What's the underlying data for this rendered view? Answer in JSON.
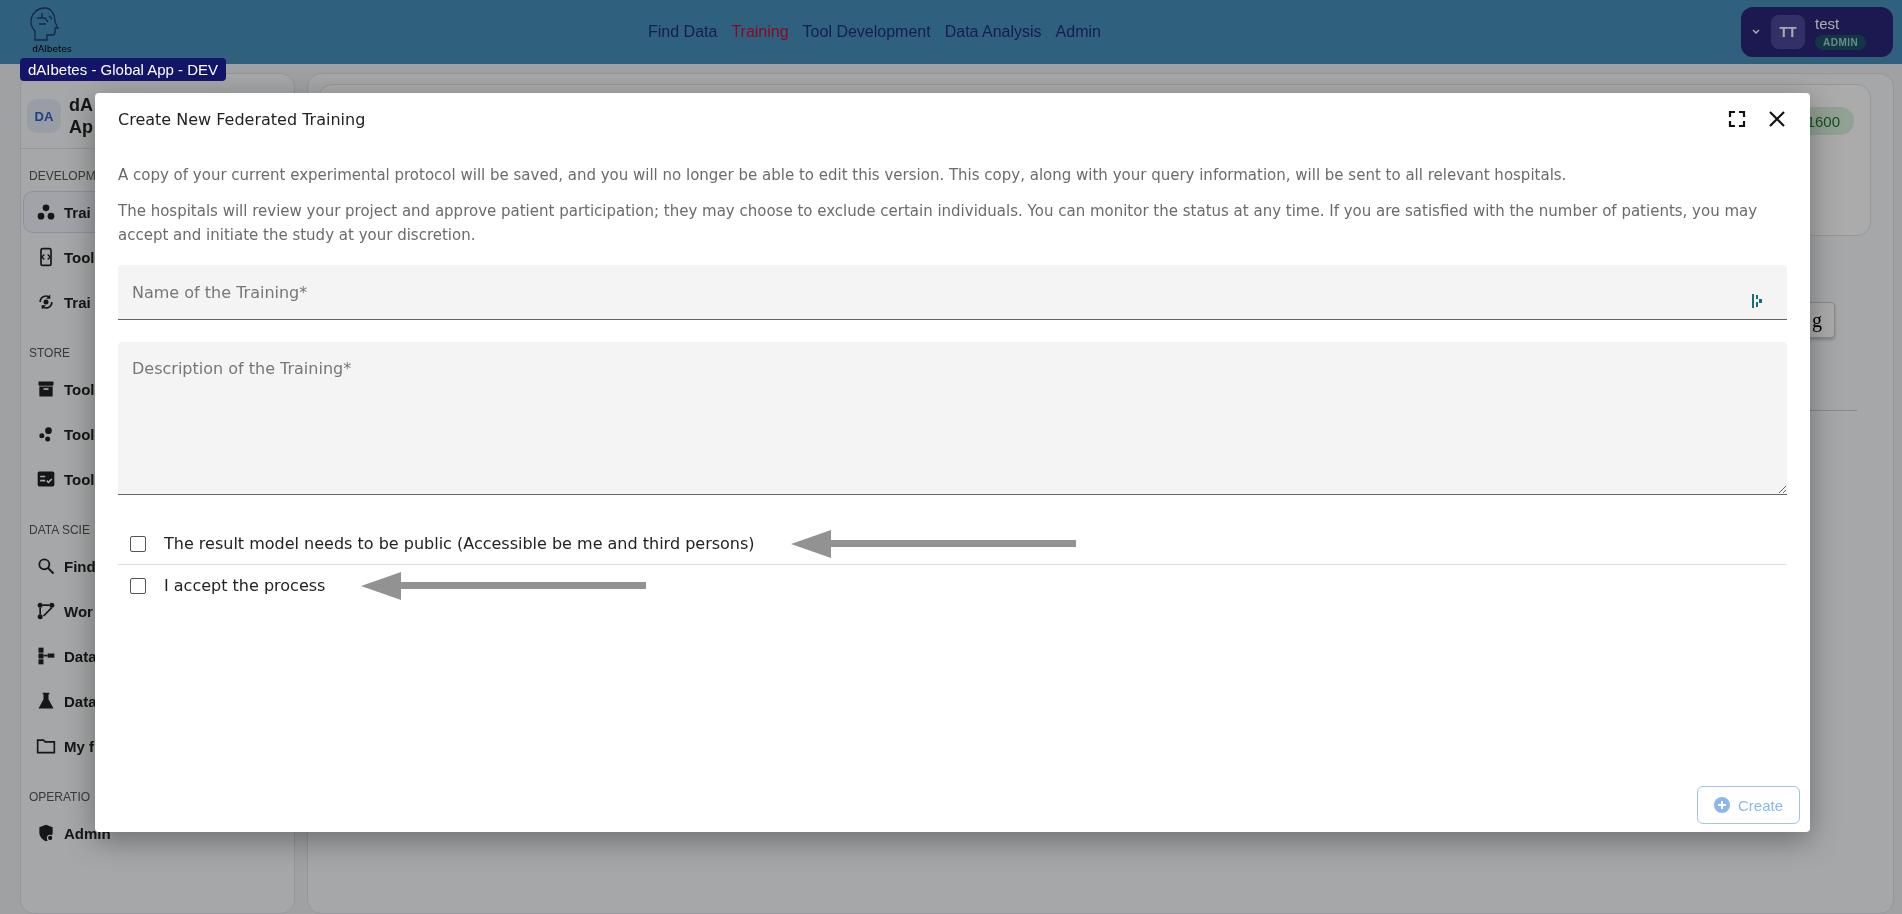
{
  "header": {
    "logo_text": "dAIbetes",
    "nav": [
      {
        "label": "Find Data",
        "selected": false
      },
      {
        "label": "Training",
        "selected": true
      },
      {
        "label": "Tool Development",
        "selected": false
      },
      {
        "label": "Data Analysis",
        "selected": false
      },
      {
        "label": "Admin",
        "selected": false
      }
    ],
    "user": {
      "initials": "TT",
      "name": "test",
      "role": "ADMIN"
    }
  },
  "tooltip": "dAIbetes - Global App - DEV",
  "sidebar": {
    "avatar": "DA",
    "title_lines": [
      "dA",
      "Ap"
    ],
    "sections": [
      {
        "title": "DEVELOPM",
        "items": [
          {
            "label": "Trai",
            "kind": "nodes",
            "selected": true
          },
          {
            "label": "Tool",
            "kind": "code",
            "selected": false
          },
          {
            "label": "Trai",
            "kind": "cycle",
            "selected": false
          }
        ]
      },
      {
        "title": "STORE",
        "items": [
          {
            "label": "Tool",
            "kind": "archive",
            "selected": false
          },
          {
            "label": "Tool",
            "kind": "dots",
            "selected": false
          },
          {
            "label": "Tool",
            "kind": "checklist",
            "selected": false
          }
        ]
      },
      {
        "title": "DATA SCIE",
        "items": [
          {
            "label": "Find",
            "kind": "search",
            "selected": false
          },
          {
            "label": "Wor",
            "kind": "workflow",
            "selected": false
          },
          {
            "label": "Data",
            "kind": "tree",
            "selected": false
          },
          {
            "label": "Data",
            "kind": "flask",
            "selected": false
          },
          {
            "label": "My f",
            "kind": "folder",
            "selected": false
          }
        ]
      },
      {
        "title": "OPERATIO",
        "items": [
          {
            "label": "Admin",
            "kind": "shield",
            "selected": false
          }
        ]
      }
    ]
  },
  "main": {
    "badge": "1600",
    "button": "g"
  },
  "dialog": {
    "title": "Create New Federated Training",
    "paragraphs": [
      "A copy of your current experimental protocol will be saved, and you will no longer be able to edit this version. This copy, along with your query information, will be sent to all relevant hospitals.",
      "The hospitals will review your project and approve patient participation; they may choose to exclude certain individuals. You can monitor the status at any time. If you are satisfied with the number of patients, you may accept and initiate the study at your discretion."
    ],
    "fields": [
      {
        "kind": "input",
        "placeholder": "Name of the Training*"
      },
      {
        "kind": "textarea",
        "placeholder": "Description of the Training*"
      }
    ],
    "checkboxes": [
      {
        "label": "The result model needs to be public (Accessible be me and third persons)",
        "checked": false
      },
      {
        "label": "I accept the process",
        "checked": false
      }
    ],
    "create_button": {
      "label": "Create",
      "disabled": true
    }
  }
}
